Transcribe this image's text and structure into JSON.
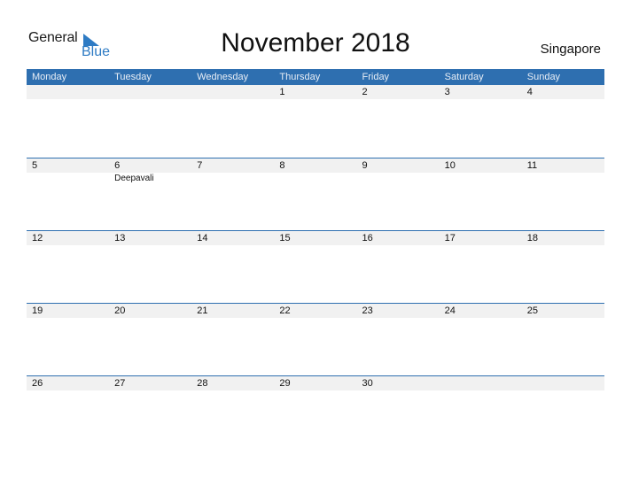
{
  "logo": {
    "word1": "General",
    "word2": "Blue"
  },
  "title": "November 2018",
  "country": "Singapore",
  "colors": {
    "header": "#2e6fb0",
    "date_strip": "#f1f1f1",
    "brand_blue": "#2e7bc4"
  },
  "weekdays": [
    "Monday",
    "Tuesday",
    "Wednesday",
    "Thursday",
    "Friday",
    "Saturday",
    "Sunday"
  ],
  "weeks": [
    {
      "days": [
        "",
        "",
        "",
        "1",
        "2",
        "3",
        "4"
      ],
      "events": [
        "",
        "",
        "",
        "",
        "",
        "",
        ""
      ]
    },
    {
      "days": [
        "5",
        "6",
        "7",
        "8",
        "9",
        "10",
        "11"
      ],
      "events": [
        "",
        "Deepavali",
        "",
        "",
        "",
        "",
        ""
      ]
    },
    {
      "days": [
        "12",
        "13",
        "14",
        "15",
        "16",
        "17",
        "18"
      ],
      "events": [
        "",
        "",
        "",
        "",
        "",
        "",
        ""
      ]
    },
    {
      "days": [
        "19",
        "20",
        "21",
        "22",
        "23",
        "24",
        "25"
      ],
      "events": [
        "",
        "",
        "",
        "",
        "",
        "",
        ""
      ]
    },
    {
      "days": [
        "26",
        "27",
        "28",
        "29",
        "30",
        "",
        ""
      ],
      "events": [
        "",
        "",
        "",
        "",
        "",
        "",
        ""
      ]
    }
  ]
}
